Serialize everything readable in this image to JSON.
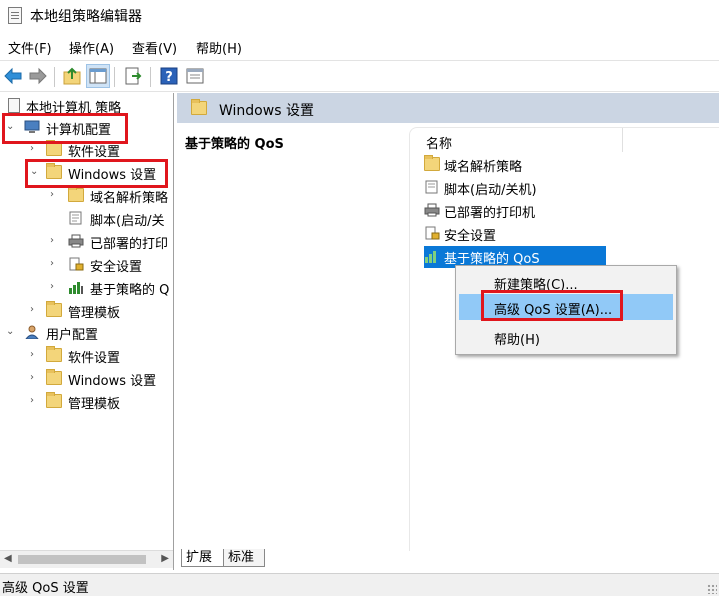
{
  "window": {
    "title": "本地组策略编辑器"
  },
  "menu": [
    "文件(F)",
    "操作(A)",
    "查看(V)",
    "帮助(H)"
  ],
  "toolbar": {
    "icons": [
      "back-arrow-icon",
      "forward-arrow-icon",
      "up-folder-icon",
      "show-tree-icon",
      "export-list-icon",
      "help-icon",
      "properties-icon"
    ]
  },
  "tree": {
    "root": "本地计算机 策略",
    "computer_config": "计算机配置",
    "software_settings": "软件设置",
    "windows_settings": "Windows 设置",
    "dns_policy": "域名解析策略",
    "scripts": "脚本(启动/关",
    "printers": "已部署的打印",
    "security": "安全设置",
    "qos": "基于策略的 Q",
    "admin_templates": "管理模板",
    "user_config": "用户配置",
    "user_software": "软件设置",
    "user_windows": "Windows 设置",
    "user_admin": "管理模板"
  },
  "main": {
    "header": "Windows 设置",
    "description_title": "基于策略的 QoS",
    "column_name": "名称",
    "items": [
      "域名解析策略",
      "脚本(启动/关机)",
      "已部署的打印机",
      "安全设置",
      "基于策略的 QoS"
    ],
    "tabs": [
      "扩展",
      "标准"
    ]
  },
  "context_menu": {
    "items": [
      "新建策略(C)...",
      "高级 QoS 设置(A)...",
      "帮助(H)"
    ]
  },
  "status": {
    "text": "高级 QoS 设置"
  },
  "colors": {
    "highlight": "#0a78d7",
    "menu_hot": "#91c9f7",
    "annotation": "#e0161d",
    "header_band": "#cbd5e3"
  }
}
